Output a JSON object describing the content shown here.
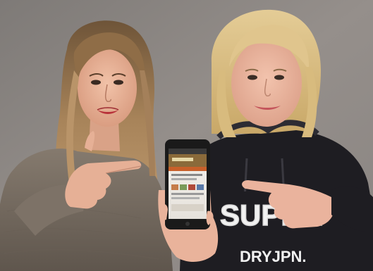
{
  "photo": {
    "hoodie_print_top": "SUPER",
    "hoodie_print_bottom": "DRYJPN."
  },
  "colors": {
    "wall": "#8f8a86",
    "left_hair": "#b08a60",
    "right_hair": "#d9c08a",
    "skin": "#e8b49c",
    "sweater": "#7a6f63",
    "hoodie": "#1e1d22",
    "phone_body": "#1a1a1a",
    "app_accent": "#c8602a"
  }
}
